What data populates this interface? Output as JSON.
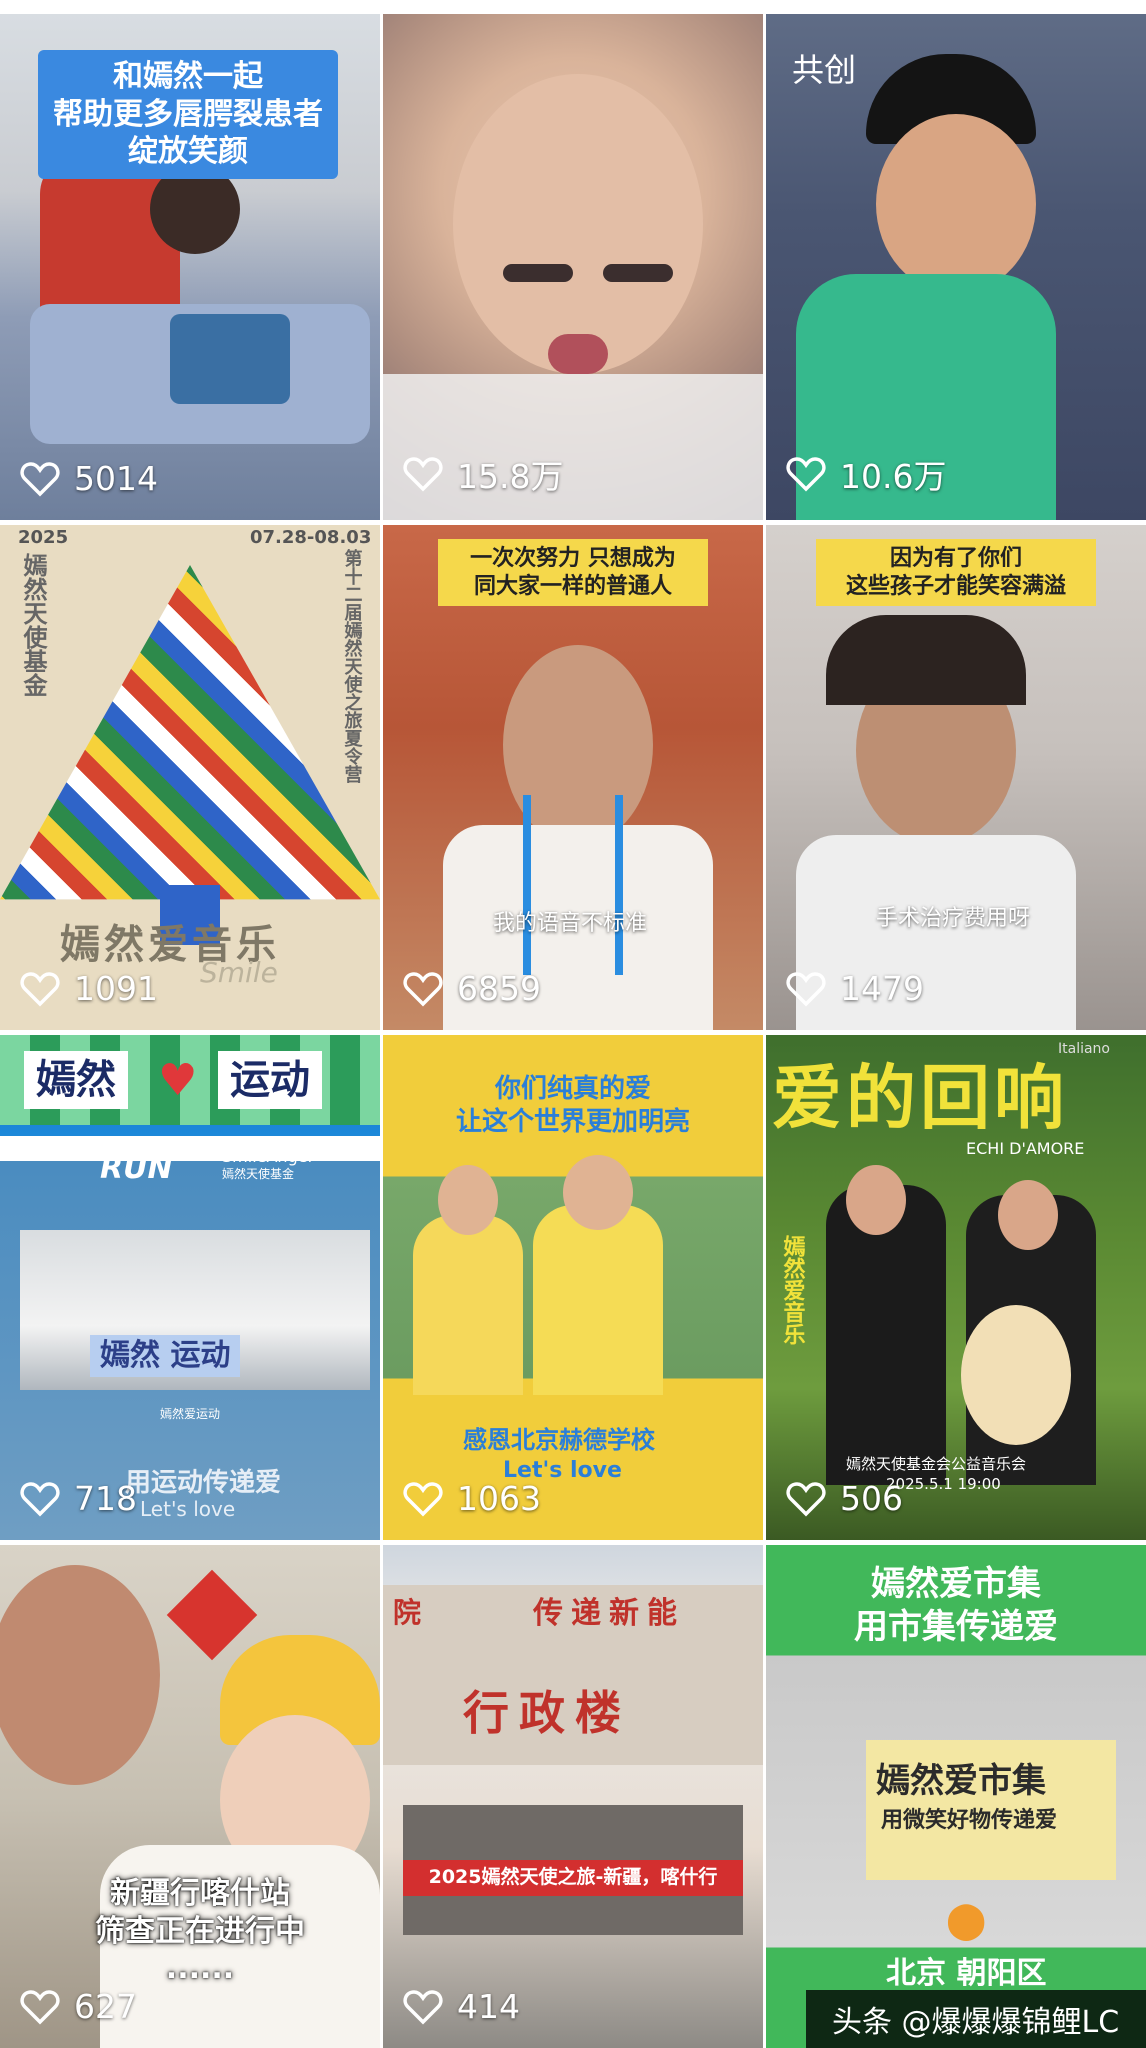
{
  "tiles": [
    {
      "id": "t1",
      "likes": "5014",
      "banner": "和嫣然一起\n帮助更多唇腭裂患者\n绽放笑颜"
    },
    {
      "id": "t2",
      "likes": "15.8万"
    },
    {
      "id": "t3",
      "likes": "10.6万",
      "tag": "共创"
    },
    {
      "id": "t4",
      "likes": "1091",
      "year": "2025",
      "dates": "07.28-08.03",
      "title_v": "嫣然天使基金",
      "title_v2": "第十二届嫣然天使之旅夏令营",
      "footer": "嫣然爱音乐",
      "script": "Smile"
    },
    {
      "id": "t5",
      "likes": "6859",
      "banner": "一次次努力 只想成为\n同大家一样的普通人",
      "caption": "我的语音不标准"
    },
    {
      "id": "t6",
      "likes": "1479",
      "banner": "因为有了你们\n这些孩子才能笑容满溢",
      "caption": "手术治疗费用呀"
    },
    {
      "id": "t7",
      "likes": "718",
      "heading_left": "嫣然",
      "heading_right": "运动",
      "brand": "RUN",
      "brand2": "SmileAngel",
      "brand3": "嫣然天使基金",
      "sign": "嫣然 运动",
      "sub": "嫣然爱运动",
      "footer1": "用运动传递爱",
      "footer2": "Let's love"
    },
    {
      "id": "t8",
      "likes": "1063",
      "banner": "你们纯真的爱\n让这个世界更加明亮",
      "footer1": "感恩北京赫德学校",
      "footer2": "Let's love"
    },
    {
      "id": "t9",
      "likes": "506",
      "title": "爱的回响",
      "subtitle": "ECHI D'AMORE",
      "vertical": "嫣然爱音乐",
      "line": "嫣然天使基金会公益音乐会",
      "time": "2025.5.1 19:00",
      "corner": "Italiano"
    },
    {
      "id": "t10",
      "likes": "627",
      "banner": "新疆行喀什站\n筛查正在进行中\n......"
    },
    {
      "id": "t11",
      "likes": "414",
      "building_top": "传递新能",
      "building": "行政楼",
      "banner": "2025嫣然天使之旅-新疆，喀什行",
      "left_side": "院"
    },
    {
      "id": "t12",
      "likes": "",
      "banner": "嫣然爱市集\n用市集传递爱",
      "sign1": "嫣然爱市集",
      "sign2": "用微笑好物传递爱",
      "loc": "北京 朝阳区"
    }
  ],
  "watermark": "头条 @爆爆爆锦鲤LC",
  "colors": {
    "heart": "#ffffff",
    "banner_blue": "#2f7fd8",
    "banner_yellow": "#f3d84a",
    "green": "#3fb45a"
  }
}
